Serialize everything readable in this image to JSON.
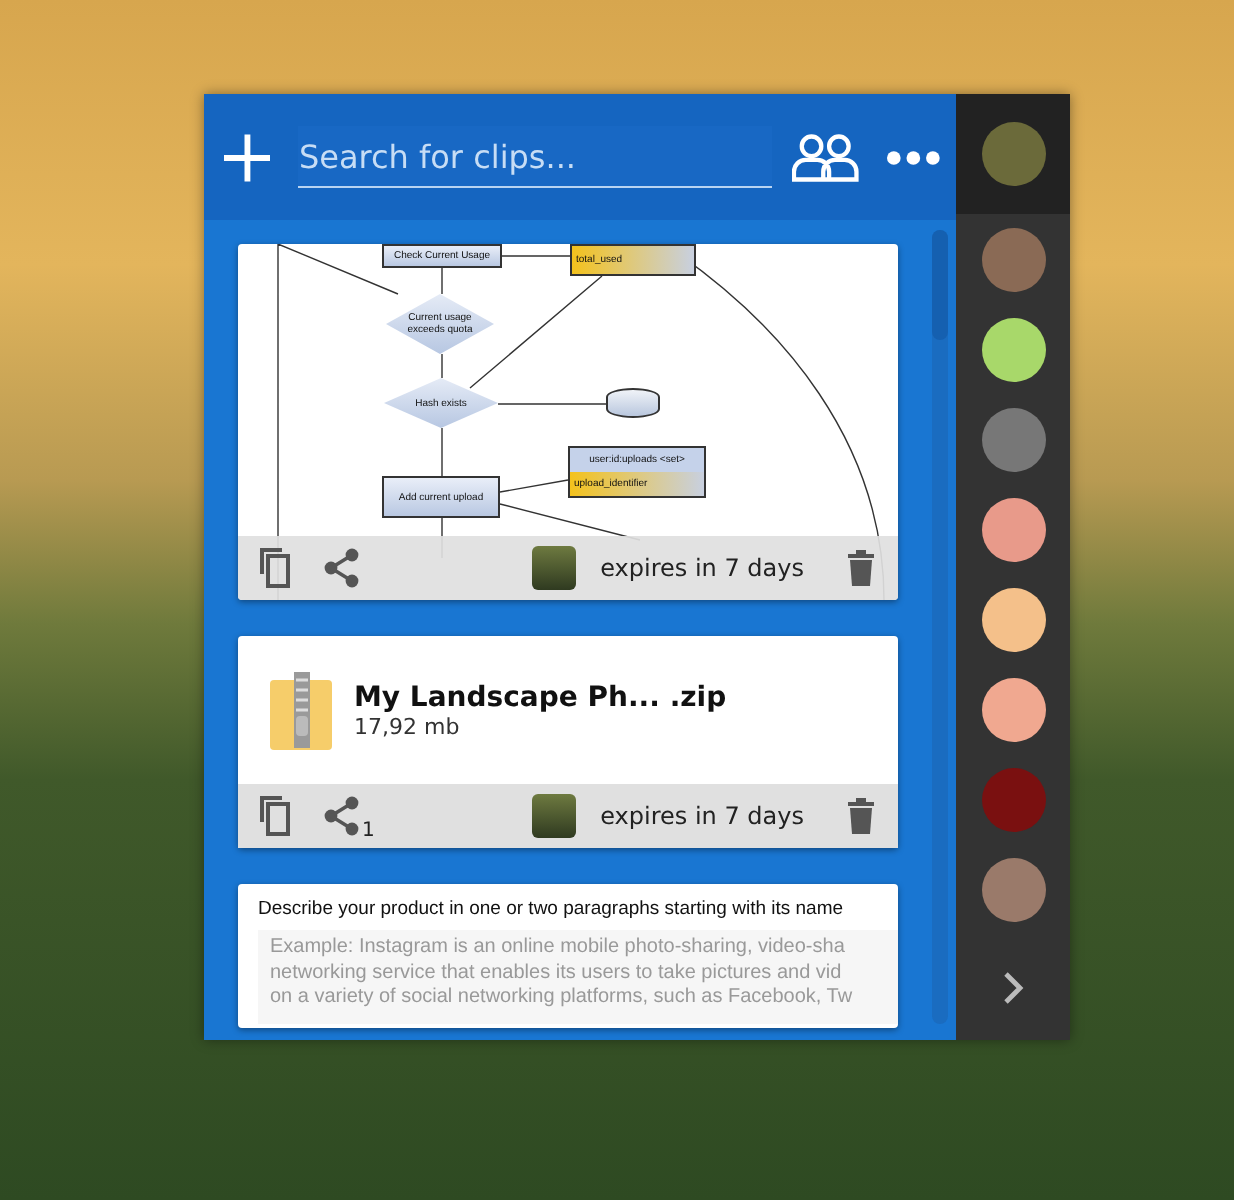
{
  "header": {
    "search": {
      "placeholder": "Search for clips..."
    }
  },
  "clips": [
    {
      "kind": "diagram",
      "nodes": [
        {
          "kind": "process",
          "label": "Check Current Usage"
        },
        {
          "kind": "data",
          "label": "total_used"
        },
        {
          "kind": "decision",
          "label": "Current usage exceeds quota"
        },
        {
          "kind": "decision",
          "label": "Hash exists"
        },
        {
          "kind": "database"
        },
        {
          "kind": "data",
          "label": "user:id:uploads <set>",
          "sub": "upload_identifier"
        },
        {
          "kind": "process",
          "label": "Add current upload"
        }
      ],
      "expires": "expires in 7 days"
    },
    {
      "kind": "file",
      "name": "My Landscape Ph... .zip",
      "size": "17,92 mb",
      "shares": "1",
      "expires": "expires in 7 days"
    },
    {
      "kind": "text",
      "title": "Describe your product in one or two paragraphs starting with its name",
      "lines": [
        "Example: Instagram is an online mobile photo-sharing, video-sha",
        "networking service that enables its users to take pictures and vid",
        "on a variety of social networking platforms, such as Facebook, Tw"
      ]
    }
  ],
  "contacts": [
    {
      "selected": true,
      "color": "#6b6a3a"
    },
    {
      "selected": false,
      "color": "#8a6a55"
    },
    {
      "selected": false,
      "color": "#a8d86a"
    },
    {
      "selected": false,
      "color": "#777777"
    },
    {
      "selected": false,
      "color": "#e89a8a"
    },
    {
      "selected": false,
      "color": "#f4c08a"
    },
    {
      "selected": false,
      "color": "#f0a890"
    },
    {
      "selected": false,
      "color": "#7a1010"
    },
    {
      "selected": false,
      "color": "#9a7a6a"
    }
  ]
}
